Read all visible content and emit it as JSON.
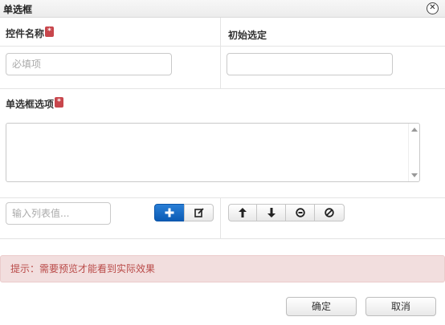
{
  "dialog": {
    "title": "单选框",
    "close_glyph": "✕"
  },
  "form": {
    "name_label": "控件名称",
    "name_placeholder": "必填项",
    "name_value": "",
    "initial_label": "初始选定",
    "initial_value": "",
    "options_label": "单选框选项",
    "options_list": [],
    "list_value_placeholder": "输入列表值...",
    "list_value": ""
  },
  "toolbar": {
    "add_icon": "plus-icon",
    "edit_icon": "edit-icon",
    "move_up_icon": "arrow-up-icon",
    "move_down_icon": "arrow-down-icon",
    "select_icon": "radio-select-icon",
    "clear_icon": "clear-icon"
  },
  "hint": {
    "text": "提示：需要预览才能看到实际效果"
  },
  "footer": {
    "ok_label": "确定",
    "cancel_label": "取消"
  },
  "colors": {
    "required_badge": "#c8464c",
    "primary_button": "#0a5bb5",
    "alert_bg": "#f2dede",
    "alert_text": "#b94a48"
  }
}
